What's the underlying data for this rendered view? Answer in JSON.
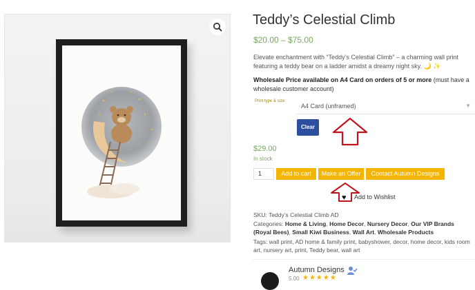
{
  "product": {
    "title": "Teddy’s Celestial Climb",
    "price_range": "$20.00 – $75.00",
    "description": "Elevate enchantment with “Teddy’s Celestial Climb” – a charming wall print featuring a teddy bear on a ladder amidst a dreamy night sky. 🌙 ✨",
    "wholesale_bold": "Wholesale Price available on A4 Card on orders of 5 or more",
    "wholesale_rest": " (must have a wholesale customer account)"
  },
  "variation": {
    "label": "Print type & size:",
    "selected": "A4 Card (unframed)",
    "clear_label": "Clear"
  },
  "purchase": {
    "price": "$29.00",
    "stock": "In stock",
    "quantity": "1",
    "add_to_cart": "Add to cart",
    "make_offer": "Make an Offer",
    "contact": "Contact Autumn Designs",
    "wishlist": "Add to Wishlist"
  },
  "meta": {
    "sku_label": "SKU:",
    "sku": "Teddy’s Celestial Climb AD",
    "categories_label": "Categories:",
    "categories": [
      "Home & Living",
      "Home Decor",
      "Nursery Decor",
      "Our VIP Brands (Royal Bees)",
      "Small Kiwi Business",
      "Wall Art",
      "Wholesale Products"
    ],
    "tags_label": "Tags:",
    "tags": "wall print, AD home & family print, babyshower, decor, home decor, kids room art, nursery art, print, Teddy bear, wall art"
  },
  "store": {
    "name": "Autumn Designs",
    "rating": "5.00",
    "stars": "★★★★★"
  },
  "colors": {
    "accent_price": "#77a464",
    "button": "#f5b400",
    "clear_button": "#2e4fa0",
    "annotation_arrow": "#c0141c"
  }
}
